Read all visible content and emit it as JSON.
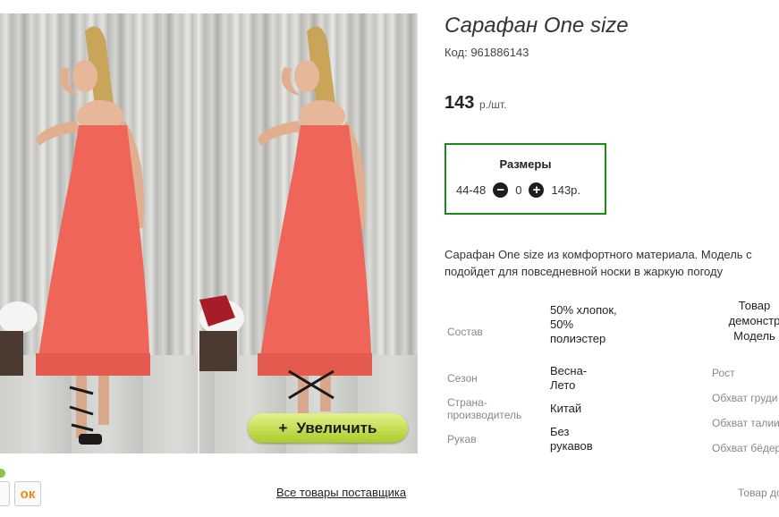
{
  "product": {
    "title": "Сарафан One size",
    "code": "Код: 961886143",
    "price": "143",
    "price_unit": "р./шт."
  },
  "sizes": {
    "title": "Размеры",
    "size": "44-48",
    "quantity": "0",
    "price": "143р."
  },
  "description": {
    "line1": "Сарафан One size из комфортного материала. Модель с",
    "line2": "подойдет для повседневной носки в жаркую погоду"
  },
  "properties": [
    {
      "label": "Состав",
      "value": "50% хлопок, 50% полиэстер"
    },
    {
      "label": "Сезон",
      "value": "Весна-Лето"
    },
    {
      "label": "Страна-производитель",
      "value": "Китай"
    },
    {
      "label": "Рукав",
      "value": "Без рукавов"
    }
  ],
  "model_info": {
    "heading": "Товар демонстр Модель",
    "height": "Рост",
    "bust": "Обхват груди",
    "waist": "Обхват талии",
    "hips": "Обхват бёдер",
    "footer": "Товар до"
  },
  "gallery": {
    "zoom_label": "Увеличить",
    "zoom_icon": "+"
  },
  "links": {
    "all_goods": "Все товары поставщика"
  },
  "social": {
    "ok_icon": "ok-icon",
    "ok_glyph": "ок"
  },
  "colors": {
    "sizes_border": "#1a8a1a",
    "zoom_button": "#c4e04a",
    "dress": "#f0655a"
  }
}
